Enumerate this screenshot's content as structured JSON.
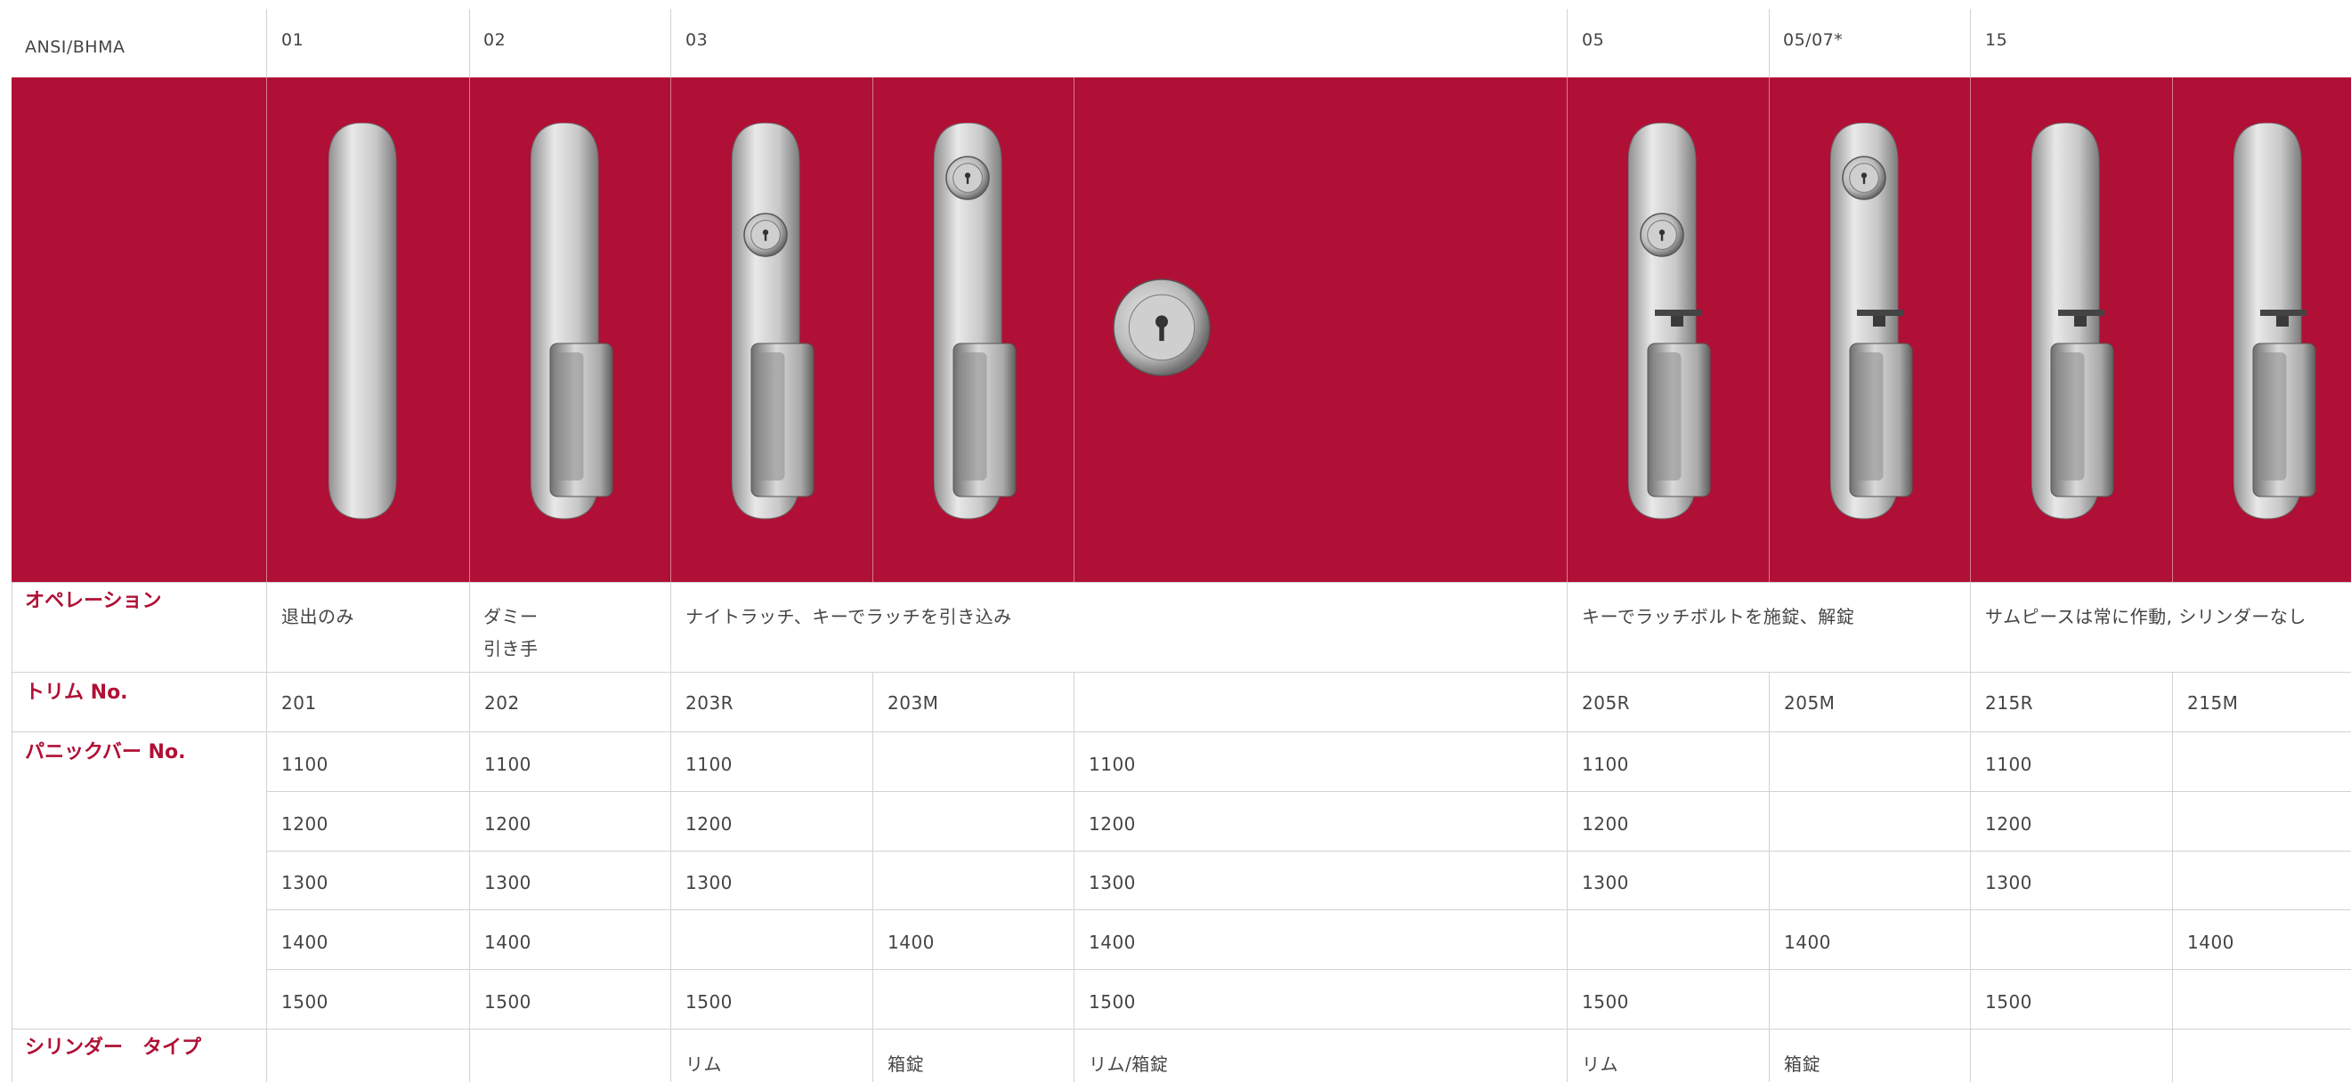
{
  "header": {
    "ansi": "ANSI/BHMA",
    "codes": [
      "01",
      "02",
      "03",
      "05",
      "05/07*",
      "15"
    ]
  },
  "colors": {
    "accent": "#b01035",
    "text": "#444444",
    "rule": "#d2d2d2"
  },
  "trims": [
    {
      "col": 1,
      "type": "plain-pull-plate-icon"
    },
    {
      "col": 2,
      "type": "pull-handle-icon"
    },
    {
      "col": 3,
      "type": "cylinder-pull-icon"
    },
    {
      "col": 4,
      "type": "cylinder-top-pull-icon"
    },
    {
      "col": 5,
      "type": "rim-cylinder-icon"
    },
    {
      "col": 6,
      "type": "cylinder-thumbturn-pull-icon"
    },
    {
      "col": 7,
      "type": "cylinder-top-thumbturn-pull-icon"
    },
    {
      "col": 8,
      "type": "thumbturn-pull-icon"
    },
    {
      "col": 9,
      "type": "thumbturn-pull-icon"
    }
  ],
  "rows": {
    "operation": {
      "label": "オペレーション",
      "c01": "退出のみ",
      "c02_line1": "ダミー",
      "c02_line2": "引き手",
      "c03": "ナイトラッチ、キーでラッチを引き込み",
      "c05": "キーでラッチボルトを施錠、解錠",
      "c15": "サムピースは常に作動, シリンダーなし"
    },
    "trim_no": {
      "label": "トリム No.",
      "values": [
        "201",
        "202",
        "203R",
        "203M",
        "",
        "205R",
        "205M",
        "215R",
        "215M"
      ]
    },
    "panic_bar": {
      "label": "パニックバー No.",
      "grid": [
        [
          "1100",
          "1100",
          "1100",
          "",
          "1100",
          "1100",
          "",
          "1100",
          ""
        ],
        [
          "1200",
          "1200",
          "1200",
          "",
          "1200",
          "1200",
          "",
          "1200",
          ""
        ],
        [
          "1300",
          "1300",
          "1300",
          "",
          "1300",
          "1300",
          "",
          "1300",
          ""
        ],
        [
          "1400",
          "1400",
          "",
          "1400",
          "1400",
          "",
          "1400",
          "",
          "1400"
        ],
        [
          "1500",
          "1500",
          "1500",
          "",
          "1500",
          "1500",
          "",
          "1500",
          ""
        ]
      ]
    },
    "cylinder": {
      "label": "シリンダー　タイプ",
      "values": [
        "",
        "",
        "リム",
        "箱錠",
        "リム/箱錠",
        "リム",
        "箱錠",
        "",
        ""
      ]
    }
  }
}
